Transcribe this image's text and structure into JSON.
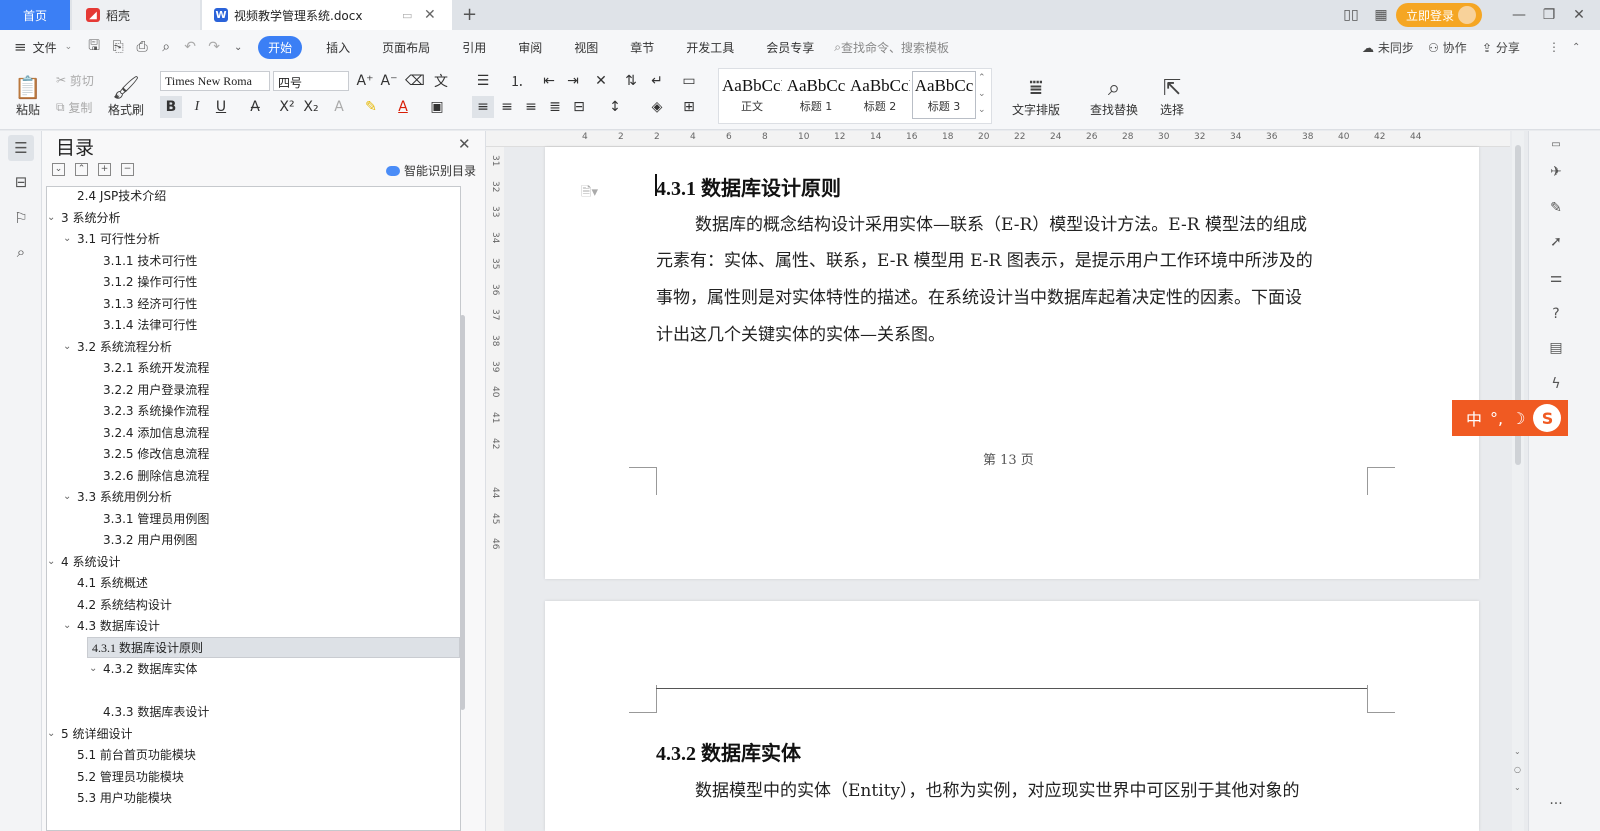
{
  "tabs": {
    "home": "首页",
    "daoke": "稻壳",
    "doc": "视频教学管理系统.docx",
    "new_tab": "+"
  },
  "titlebar": {
    "login": "立即登录"
  },
  "menu": {
    "file": "文件",
    "items": [
      "开始",
      "插入",
      "页面布局",
      "引用",
      "审阅",
      "视图",
      "章节",
      "开发工具",
      "会员专享"
    ],
    "search_placeholder": "查找命令、搜索模板",
    "sync": "未同步",
    "collab": "协作",
    "share": "分享"
  },
  "ribbon": {
    "paste": "粘贴",
    "cut": "剪切",
    "copy": "复制",
    "format_painter": "格式刷",
    "font_name": "Times New Roma",
    "font_size": "四号",
    "styles": [
      {
        "preview": "AaBbCcI",
        "name": "正文"
      },
      {
        "preview": "AaBbCc",
        "name": "标题 1"
      },
      {
        "preview": "AaBbCcI",
        "name": "标题 2"
      },
      {
        "preview": "AaBbCc",
        "name": "标题 3"
      }
    ],
    "text_layout": "文字排版",
    "find_replace": "查找替换",
    "select": "选择"
  },
  "toc": {
    "title": "目录",
    "smart": "智能识别目录",
    "items": [
      {
        "text": "2.4 JSP技术介绍",
        "lvl": 2,
        "chev": ""
      },
      {
        "text": "3  系统分析",
        "lvl": 1,
        "chev": "v"
      },
      {
        "text": "3.1  可行性分析",
        "lvl": 2,
        "chev": "v"
      },
      {
        "text": "3.1.1  技术可行性",
        "lvl": 3,
        "chev": ""
      },
      {
        "text": "3.1.2 操作可行性",
        "lvl": 3,
        "chev": ""
      },
      {
        "text": "3.1.3  经济可行性",
        "lvl": 3,
        "chev": ""
      },
      {
        "text": "3.1.4  法律可行性",
        "lvl": 3,
        "chev": ""
      },
      {
        "text": "3.2 系统流程分析",
        "lvl": 2,
        "chev": "v"
      },
      {
        "text": "3.2.1 系统开发流程",
        "lvl": 3,
        "chev": ""
      },
      {
        "text": "3.2.2  用户登录流程",
        "lvl": 3,
        "chev": ""
      },
      {
        "text": "3.2.3  系统操作流程",
        "lvl": 3,
        "chev": ""
      },
      {
        "text": "3.2.4  添加信息流程",
        "lvl": 3,
        "chev": ""
      },
      {
        "text": "3.2.5  修改信息流程",
        "lvl": 3,
        "chev": ""
      },
      {
        "text": "3.2.6  删除信息流程",
        "lvl": 3,
        "chev": ""
      },
      {
        "text": "3.3 系统用例分析",
        "lvl": 2,
        "chev": "v"
      },
      {
        "text": "3.3.1 管理员用例图",
        "lvl": 3,
        "chev": ""
      },
      {
        "text": "3.3.2 用户用例图",
        "lvl": 3,
        "chev": ""
      },
      {
        "text": "4  系统设计",
        "lvl": 1,
        "chev": "v"
      },
      {
        "text": "4.1  系统概述",
        "lvl": 2,
        "chev": ""
      },
      {
        "text": "4.2  系统结构设计",
        "lvl": 2,
        "chev": ""
      },
      {
        "text": "4.3 数据库设计",
        "lvl": 2,
        "chev": "v"
      },
      {
        "text": "4.3.1  数据库设计原则",
        "lvl": 3,
        "chev": "",
        "selected": true
      },
      {
        "text": "4.3.2  数据库实体",
        "lvl": 3,
        "chev": "v"
      },
      {
        "text": "",
        "lvl": 3,
        "chev": ""
      },
      {
        "text": "4.3.3  数据库表设计",
        "lvl": 3,
        "chev": ""
      },
      {
        "text": "5 统详细设计",
        "lvl": 1,
        "chev": "v"
      },
      {
        "text": "5.1 前台首页功能模块",
        "lvl": 2,
        "chev": ""
      },
      {
        "text": "5.2 管理员功能模块",
        "lvl": 2,
        "chev": ""
      },
      {
        "text": "5.3 用户功能模块",
        "lvl": 2,
        "chev": ""
      }
    ]
  },
  "ruler": {
    "h": [
      "4",
      "2",
      "2",
      "4",
      "6",
      "8",
      "10",
      "12",
      "14",
      "16",
      "18",
      "20",
      "22",
      "24",
      "26",
      "28",
      "30",
      "32",
      "34",
      "36",
      "38",
      "40",
      "42",
      "44"
    ],
    "v": [
      "31",
      "32",
      "33",
      "34",
      "35",
      "36",
      "37",
      "38",
      "39",
      "40",
      "41",
      "42",
      "44",
      "45",
      "46"
    ]
  },
  "doc": {
    "h431": "4.3.1  数据库设计原则",
    "p1": "数据库的概念结构设计采用实体—联系（E-R）模型设计方法。E-R 模型法的组成",
    "p2": "元素有：实体、属性、联系，E-R 模型用 E-R 图表示，是提示用户工作环境中所涉及的",
    "p3": "事物，属性则是对实体特性的描述。在系统设计当中数据库起着决定性的因素。下面设",
    "p4": "计出这几个关键实体的实体—关系图。",
    "footer": "第  13  页",
    "h432": "4.3.2  数据库实体",
    "p5": "数据模型中的实体（Entity），也称为实例，对应现实世界中可区别于其他对象的"
  },
  "ime": {
    "label": "中",
    "marks": "°,"
  }
}
